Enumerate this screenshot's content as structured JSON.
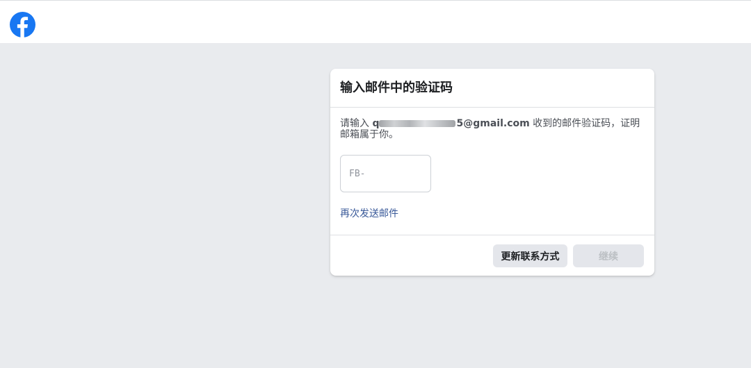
{
  "header": {
    "logo_icon": "facebook-logo-icon",
    "brand_color": "#1877f2"
  },
  "card": {
    "title": "输入邮件中的验证码",
    "message_prefix": "请输入 ",
    "email_visible_start": "q",
    "email_visible_end": "5@gmail.com",
    "message_suffix": " 收到的邮件验证码，证明邮箱属于你。",
    "code_input": {
      "value": "",
      "placeholder": "FB-"
    },
    "resend_link": "再次发送邮件",
    "update_contact_button": "更新联系方式",
    "continue_button": "继续"
  },
  "colors": {
    "page_background": "#e9ebee",
    "link": "#385898",
    "button_background": "#e4e6eb",
    "disabled_text": "#bcc0c4"
  }
}
